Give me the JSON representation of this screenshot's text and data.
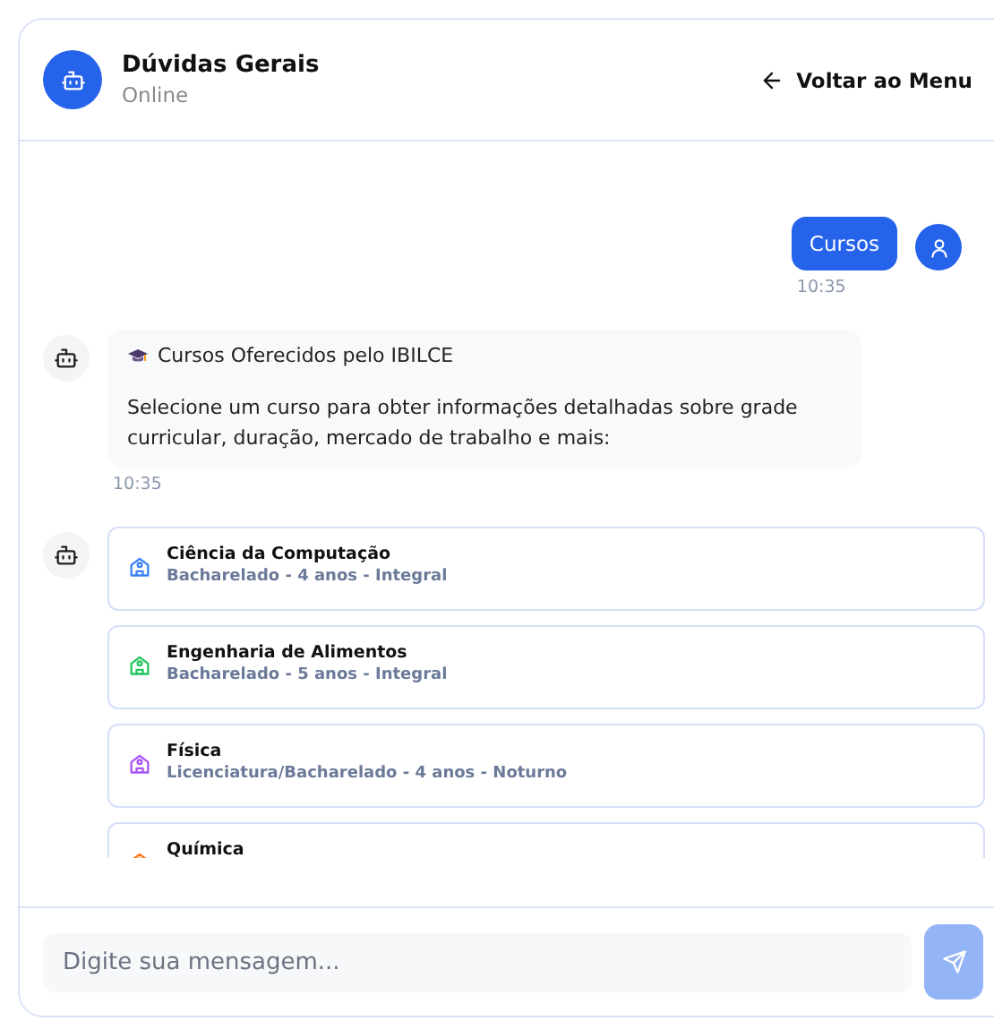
{
  "header": {
    "title": "Dúvidas Gerais",
    "status": "Online",
    "back_button": "Voltar ao Menu"
  },
  "messages": [
    {
      "kind": "user",
      "text": "Cursos",
      "time": "10:35"
    },
    {
      "kind": "bot_text",
      "title": "Cursos Oferecidos pelo IBILCE",
      "text": "Selecione um curso para obter informações detalhadas sobre grade curricular, duração, mercado de trabalho e mais:",
      "time": "10:35"
    },
    {
      "kind": "bot_courses",
      "courses": [
        {
          "name": "Ciência da Computação",
          "details": "Bacharelado - 4 anos - Integral",
          "color": "#3b82f6"
        },
        {
          "name": "Engenharia de Alimentos",
          "details": "Bacharelado - 5 anos - Integral",
          "color": "#22c55e"
        },
        {
          "name": "Física",
          "details": "Licenciatura/Bacharelado - 4 anos - Noturno",
          "color": "#a855f7"
        },
        {
          "name": "Química",
          "color": "#f97316"
        }
      ]
    }
  ],
  "input": {
    "placeholder": "Digite sua mensagem..."
  },
  "send_button": {
    "disabled": true
  }
}
